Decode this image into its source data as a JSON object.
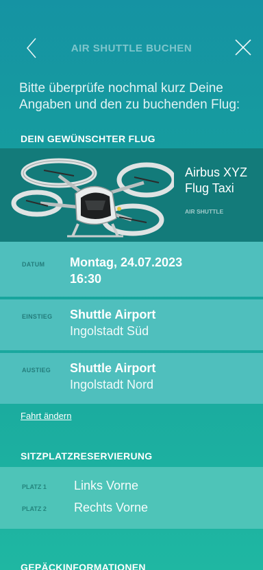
{
  "header": {
    "title": "AIR SHUTTLE BUCHEN",
    "back_icon": "chevron-left-icon",
    "close_icon": "close-icon"
  },
  "intro_text": "Bitte überprüfe nochmal kurz Deine Angaben und den zu buchenden Flug:",
  "flight_section": {
    "heading": "DEIN GEWÜNSCHTER FLUG",
    "aircraft_name": "Airbus XYZ Flug Taxi",
    "aircraft_type": "AIR SHUTTLE"
  },
  "details": {
    "date_label": "DATUM",
    "date_value": "Montag, 24.07.2023",
    "time_value": "16:30",
    "boarding_label": "EINSTIEG",
    "boarding_main": "Shuttle Airport",
    "boarding_sub": "Ingolstadt Süd",
    "exit_label": "AUSTIEG",
    "exit_main": "Shuttle Airport",
    "exit_sub": "Ingolstadt Nord"
  },
  "change_link": "Fahrt ändern",
  "seat_section": {
    "heading": "SITZPLATZRESERVIERUNG",
    "seats": [
      {
        "label": "PLATZ 1",
        "value": "Links Vorne"
      },
      {
        "label": "PLATZ 2",
        "value": "Rechts Vorne"
      }
    ]
  },
  "luggage_section": {
    "heading": "GEPÄCKINFORMATIONEN"
  }
}
